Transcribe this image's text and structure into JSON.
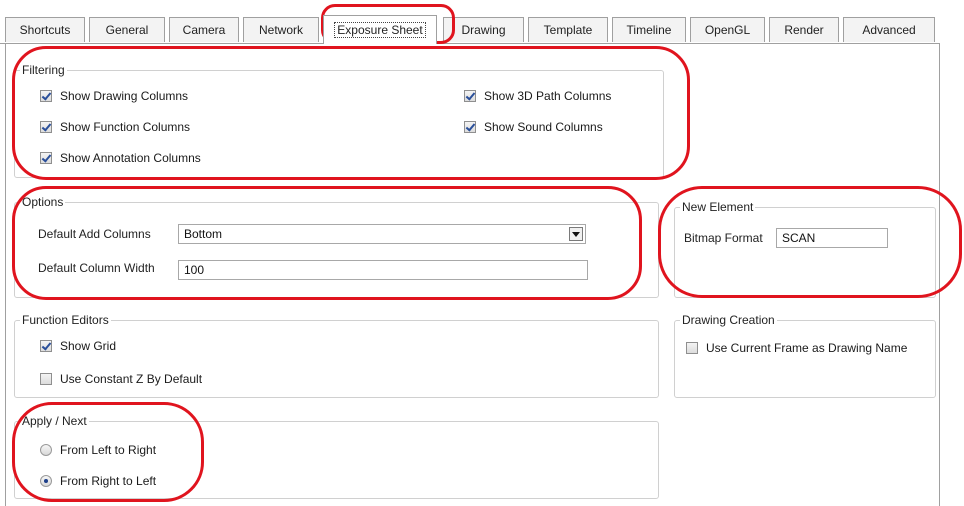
{
  "tabs": [
    {
      "label": "Shortcuts"
    },
    {
      "label": "General"
    },
    {
      "label": "Camera"
    },
    {
      "label": "Network"
    },
    {
      "label": "Exposure Sheet",
      "active": true
    },
    {
      "label": "Drawing"
    },
    {
      "label": "Template"
    },
    {
      "label": "Timeline"
    },
    {
      "label": "OpenGL"
    },
    {
      "label": "Render"
    },
    {
      "label": "Advanced"
    }
  ],
  "filtering": {
    "title": "Filtering",
    "show_drawing_columns": {
      "label": "Show Drawing Columns",
      "checked": true
    },
    "show_function_columns": {
      "label": "Show Function Columns",
      "checked": true
    },
    "show_annotation_columns": {
      "label": "Show Annotation Columns",
      "checked": true
    },
    "show_3d_path_columns": {
      "label": "Show 3D Path Columns",
      "checked": true
    },
    "show_sound_columns": {
      "label": "Show Sound Columns",
      "checked": true
    }
  },
  "options": {
    "title": "Options",
    "default_add_columns_label": "Default Add Columns",
    "default_add_columns_value": "Bottom",
    "default_column_width_label": "Default Column Width",
    "default_column_width_value": "100"
  },
  "new_element": {
    "title": "New Element",
    "bitmap_format_label": "Bitmap Format",
    "bitmap_format_value": "SCAN"
  },
  "function_editors": {
    "title": "Function Editors",
    "show_grid": {
      "label": "Show Grid",
      "checked": true
    },
    "use_constant_z": {
      "label": "Use Constant Z By Default",
      "checked": false
    }
  },
  "drawing_creation": {
    "title": "Drawing Creation",
    "use_current_frame": {
      "label": "Use Current Frame as Drawing Name",
      "checked": false
    }
  },
  "apply_next": {
    "title": "Apply / Next",
    "left_to_right": {
      "label": "From Left to Right",
      "selected": false
    },
    "right_to_left": {
      "label": "From Right to Left",
      "selected": true
    }
  },
  "colors": {
    "annotation_ring": "#e0141e",
    "check_mark": "#2a4f9a"
  }
}
